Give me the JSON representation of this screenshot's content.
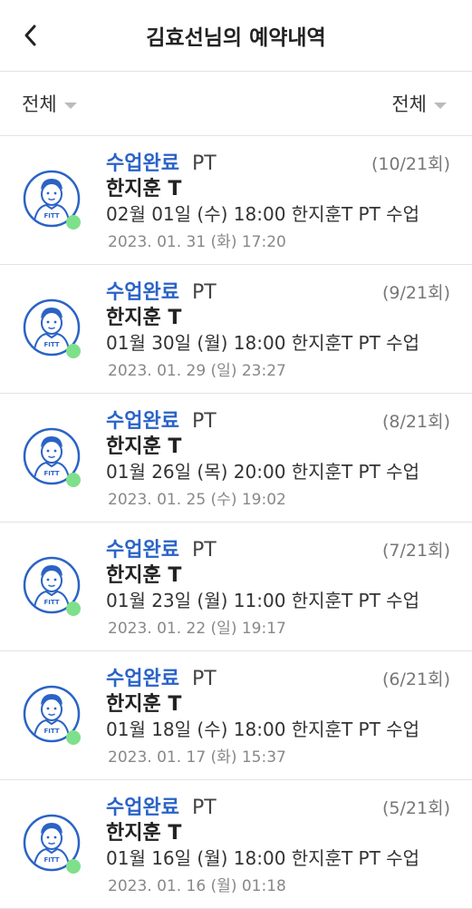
{
  "header": {
    "title": "김효선님의 예약내역",
    "back_icon": "chevron-left-icon"
  },
  "filters": {
    "left_label": "전체",
    "right_label": "전체"
  },
  "colors": {
    "status": "#2a63c6",
    "online": "#7ee08a",
    "avatar_stroke": "#2a63c6"
  },
  "avatar": {
    "badge_text": "FITT"
  },
  "reservations": [
    {
      "status": "수업완료",
      "type": "PT",
      "count": "(10/21회)",
      "trainer": "한지훈 T",
      "desc": "02월 01일 (수) 18:00 한지훈T PT 수업",
      "date": "2023. 01. 31 (화) 17:20"
    },
    {
      "status": "수업완료",
      "type": "PT",
      "count": "(9/21회)",
      "trainer": "한지훈 T",
      "desc": "01월 30일 (월) 18:00 한지훈T PT 수업",
      "date": "2023. 01. 29 (일) 23:27"
    },
    {
      "status": "수업완료",
      "type": "PT",
      "count": "(8/21회)",
      "trainer": "한지훈 T",
      "desc": "01월 26일 (목) 20:00 한지훈T PT 수업",
      "date": "2023. 01. 25 (수) 19:02"
    },
    {
      "status": "수업완료",
      "type": "PT",
      "count": "(7/21회)",
      "trainer": "한지훈 T",
      "desc": "01월 23일 (월) 11:00 한지훈T PT 수업",
      "date": "2023. 01. 22 (일) 19:17"
    },
    {
      "status": "수업완료",
      "type": "PT",
      "count": "(6/21회)",
      "trainer": "한지훈 T",
      "desc": "01월 18일 (수) 18:00 한지훈T PT 수업",
      "date": "2023. 01. 17 (화) 15:37"
    },
    {
      "status": "수업완료",
      "type": "PT",
      "count": "(5/21회)",
      "trainer": "한지훈 T",
      "desc": "01월 16일 (월) 18:00 한지훈T PT 수업",
      "date": "2023. 01. 16 (월) 01:18"
    }
  ]
}
